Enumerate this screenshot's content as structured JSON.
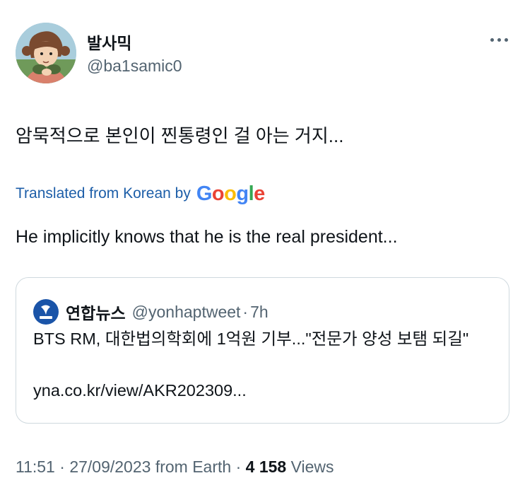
{
  "author": {
    "display_name": "발사믹",
    "handle": "@ba1samic0"
  },
  "tweet": {
    "text": "암묵적으로 본인이 찐통령인 걸 아는 거지...",
    "translated_label": "Translated from Korean by",
    "translator": [
      "G",
      "o",
      "o",
      "g",
      "l",
      "e"
    ],
    "translation": "He implicitly knows that he is the real president..."
  },
  "quoted_tweet": {
    "display_name": "연합뉴스",
    "handle": "@yonhaptweet",
    "separator": "·",
    "time": "7h",
    "text": "BTS RM, 대한법의학회에 1억원 기부...\"전문가 양성 보탬 되길\"",
    "link": "yna.co.kr/view/AKR202309...",
    "logo_text": "연합뉴스"
  },
  "meta": {
    "time": "11:51",
    "separator": "·",
    "date": "27/09/2023",
    "source": "from Earth",
    "views_count": "4 158",
    "views_label": "Views"
  },
  "colors": {
    "text_primary": "#0f1419",
    "text_secondary": "#536471",
    "translate_link": "#1d5ea8",
    "quote_border": "#cfd9de",
    "yonhap_blue": "#1a54a8"
  },
  "icons": {
    "more": "more-horizontal-icon",
    "quote_avatar": "yonhap-logo-icon"
  }
}
